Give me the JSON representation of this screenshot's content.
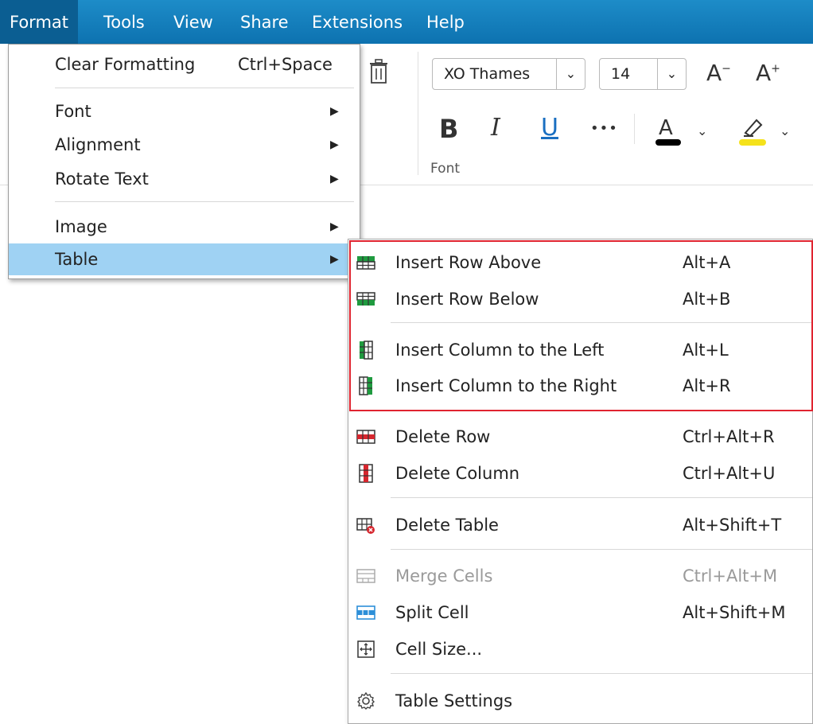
{
  "menubar": {
    "items": [
      "Format",
      "Tools",
      "View",
      "Share",
      "Extensions",
      "Help"
    ]
  },
  "toolbar": {
    "font_name": "XO Thames",
    "font_size": "14",
    "group_label": "Font",
    "icons": [
      "delete-icon",
      "decrease-font-size-icon",
      "increase-font-size-icon",
      "bold-icon",
      "italic-icon",
      "underline-icon",
      "more-icon",
      "font-color-icon",
      "highlight-icon"
    ],
    "font_color": "#000000",
    "highlight_color": "#f5e21b"
  },
  "format_menu": {
    "items": [
      {
        "label": "Clear Formatting",
        "shortcut": "Ctrl+Space"
      },
      {
        "label": "Font"
      },
      {
        "label": "Alignment"
      },
      {
        "label": "Rotate Text"
      },
      {
        "label": "Image"
      },
      {
        "label": "Table"
      }
    ]
  },
  "table_submenu": {
    "items": [
      {
        "label": "Insert Row Above",
        "shortcut": "Alt+A",
        "icon": "insert-row-above-icon"
      },
      {
        "label": "Insert Row Below",
        "shortcut": "Alt+B",
        "icon": "insert-row-below-icon"
      },
      {
        "label": "Insert Column to the Left",
        "shortcut": "Alt+L",
        "icon": "insert-column-left-icon"
      },
      {
        "label": "Insert Column to the Right",
        "shortcut": "Alt+R",
        "icon": "insert-column-right-icon"
      },
      {
        "label": "Delete Row",
        "shortcut": "Ctrl+Alt+R",
        "icon": "delete-row-icon"
      },
      {
        "label": "Delete Column",
        "shortcut": "Ctrl+Alt+U",
        "icon": "delete-column-icon"
      },
      {
        "label": "Delete Table",
        "shortcut": "Alt+Shift+T",
        "icon": "delete-table-icon"
      },
      {
        "label": "Merge Cells",
        "shortcut": "Ctrl+Alt+M",
        "icon": "merge-cells-icon",
        "disabled": true
      },
      {
        "label": "Split Cell",
        "shortcut": "Alt+Shift+M",
        "icon": "split-cell-icon"
      },
      {
        "label": "Cell Size...",
        "icon": "cell-size-icon"
      },
      {
        "label": "Table Settings",
        "icon": "settings-gear-icon"
      }
    ]
  },
  "colors": {
    "menubar": "#1082c0",
    "highlight_selected": "#9fd2f3",
    "red_outline": "#e02430",
    "icon_green": "#1f9a3f",
    "icon_red": "#d6262e",
    "icon_blue": "#2d8fd8"
  }
}
